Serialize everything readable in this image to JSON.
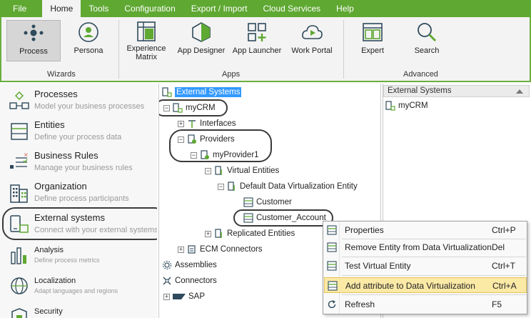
{
  "menubar": {
    "items": [
      "File",
      "Home",
      "Tools",
      "Configuration",
      "Export / Import",
      "Cloud Services",
      "Help"
    ],
    "active": "Home"
  },
  "ribbon": {
    "buttons": {
      "process": "Process",
      "persona": "Persona",
      "experience_matrix_1": "Experience",
      "experience_matrix_2": "Matrix",
      "app_designer": "App Designer",
      "app_launcher": "App Launcher",
      "work_portal": "Work Portal",
      "expert": "Expert",
      "search": "Search"
    },
    "groups": {
      "wizards": "Wizards",
      "apps": "Apps",
      "advanced": "Advanced"
    }
  },
  "leftnav": {
    "processes": {
      "title": "Processes",
      "subtitle": "Model your business processes"
    },
    "entities": {
      "title": "Entities",
      "subtitle": "Define your process data"
    },
    "business_rules": {
      "title": "Business Rules",
      "subtitle": "Manage your business rules"
    },
    "organization": {
      "title": "Organization",
      "subtitle": "Define process participants"
    },
    "external_systems": {
      "title": "External systems",
      "subtitle": "Connect with your external systems"
    },
    "analysis": {
      "title": "Analysis",
      "subtitle": "Define process metrics"
    },
    "localization": {
      "title": "Localization",
      "subtitle": "Adapt languages and regions"
    },
    "security": {
      "title": "Security"
    }
  },
  "tree": {
    "root": "External Systems",
    "mycrm": "myCRM",
    "interfaces": "Interfaces",
    "providers": "Providers",
    "myprovider1": "myProvider1",
    "virtual_entities": "Virtual Entities",
    "default_dv_entity": "Default Data Virtualization Entity",
    "customer": "Customer",
    "customer_account": "Customer_Account",
    "replicated_entities": "Replicated Entities",
    "ecm_connectors": "ECM Connectors",
    "assemblies": "Assemblies",
    "connectors": "Connectors",
    "sap": "SAP"
  },
  "rightpanel": {
    "header": "External Systems",
    "items": [
      "myCRM"
    ]
  },
  "context_menu": {
    "properties": {
      "label": "Properties",
      "shortcut": "Ctrl+P"
    },
    "remove": {
      "label": "Remove Entity from Data Virtualization",
      "shortcut": "Del"
    },
    "test": {
      "label": "Test Virtual Entity",
      "shortcut": "Ctrl+T"
    },
    "add_attribute": {
      "label": "Add attribute to Data Virtualization",
      "shortcut": "Ctrl+A"
    },
    "refresh": {
      "label": "Refresh",
      "shortcut": "F5"
    }
  },
  "colors": {
    "brand_green": "#5fa832",
    "selection_blue": "#3399ff",
    "menu_highlight": "#fbe9a6"
  }
}
